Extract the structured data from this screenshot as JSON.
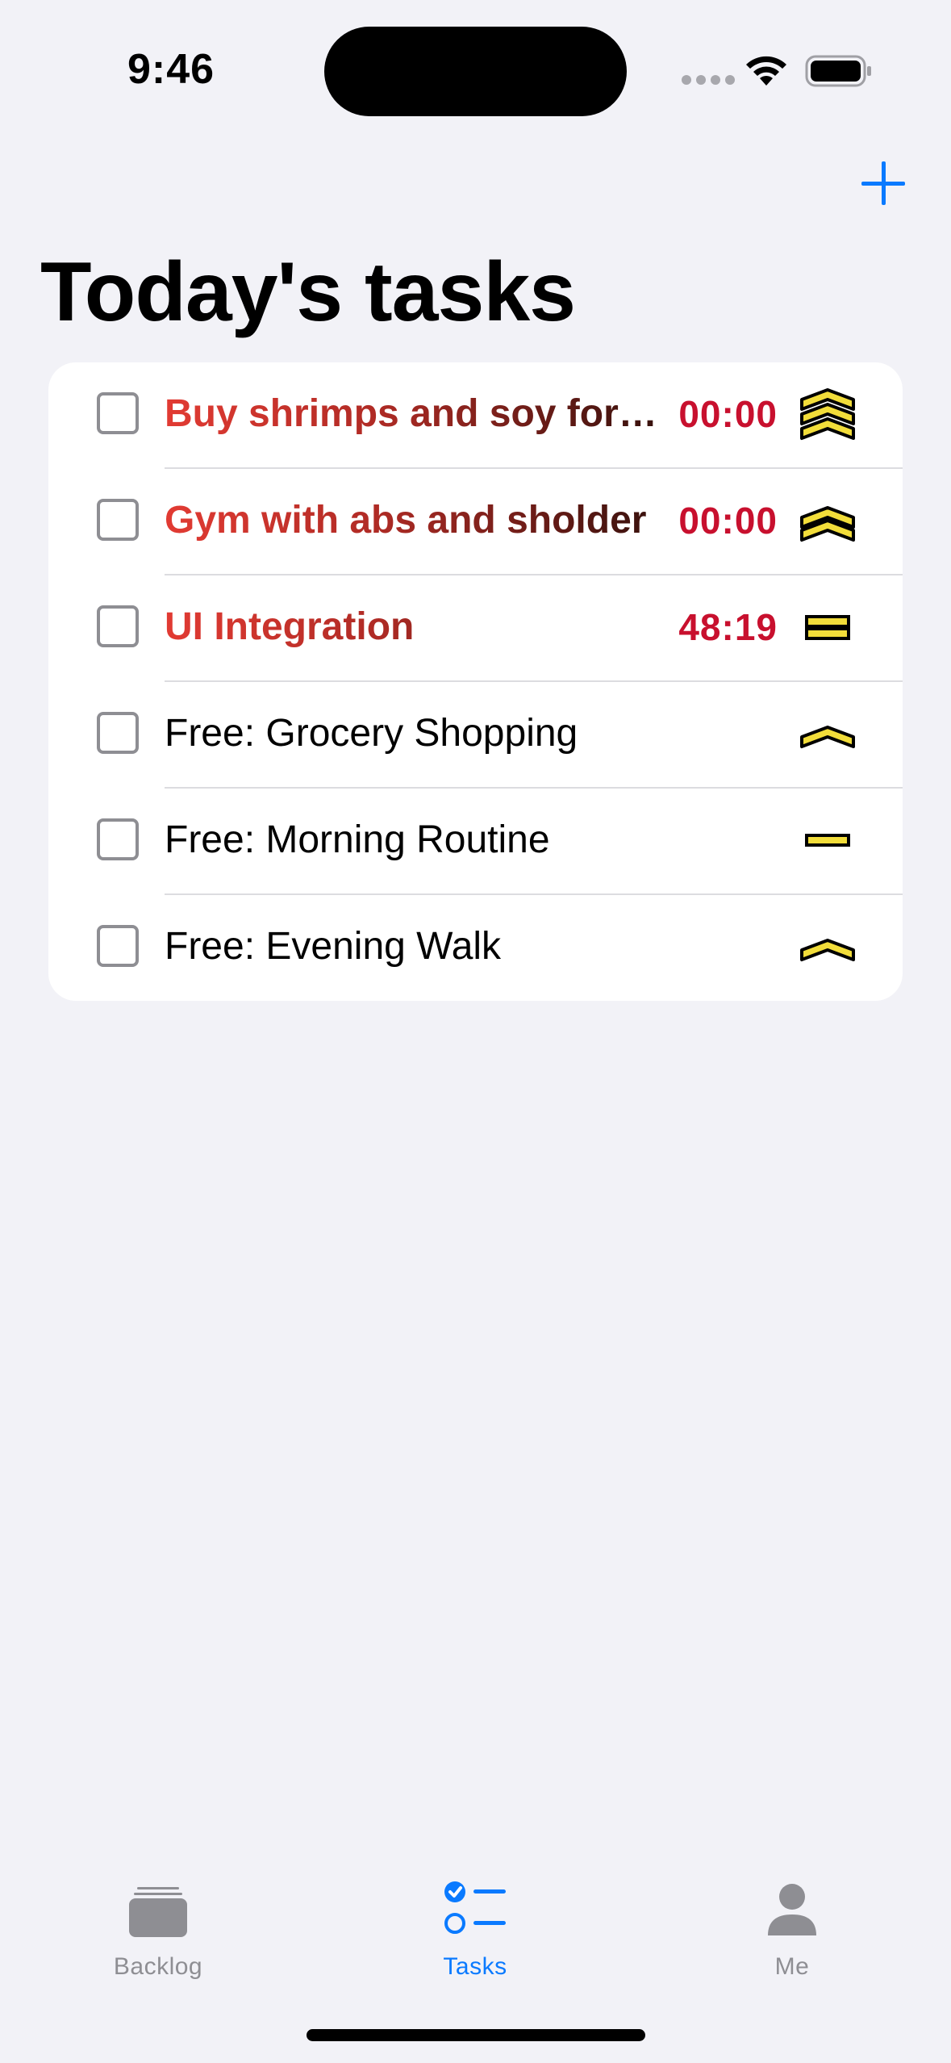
{
  "status_bar": {
    "time": "9:46"
  },
  "header": {
    "title": "Today's tasks",
    "add_icon": "plus-icon"
  },
  "tasks": [
    {
      "title": "Buy shrimps and soy for…",
      "timer": "00:00",
      "state": "overdue",
      "priority": "highest",
      "priority_icon": "triple-chevron-up-icon"
    },
    {
      "title": "Gym with abs and sholder",
      "timer": "00:00",
      "state": "overdue",
      "priority": "high",
      "priority_icon": "double-chevron-up-icon"
    },
    {
      "title": "UI Integration",
      "timer": "48:19",
      "state": "overdue",
      "priority": "medium",
      "priority_icon": "double-bar-icon"
    },
    {
      "title": "Free: Grocery Shopping",
      "timer": "",
      "state": "free",
      "priority": "low",
      "priority_icon": "single-chevron-up-icon"
    },
    {
      "title": "Free: Morning Routine",
      "timer": "",
      "state": "free",
      "priority": "normal",
      "priority_icon": "single-bar-icon"
    },
    {
      "title": "Free: Evening Walk",
      "timer": "",
      "state": "free",
      "priority": "low",
      "priority_icon": "single-chevron-up-icon"
    }
  ],
  "tabbar": {
    "tabs": [
      {
        "label": "Backlog",
        "icon": "tray-stack-icon",
        "selected": false
      },
      {
        "label": "Tasks",
        "icon": "checklist-icon",
        "selected": true
      },
      {
        "label": "Me",
        "icon": "person-icon",
        "selected": false
      }
    ]
  },
  "colors": {
    "accent": "#0a7aff",
    "background": "#f2f2f7",
    "timer": "#c8102e",
    "overdue_start": "#e23b33",
    "priority_fill": "#f2dd3a",
    "tab_inactive": "#8e8e93"
  }
}
